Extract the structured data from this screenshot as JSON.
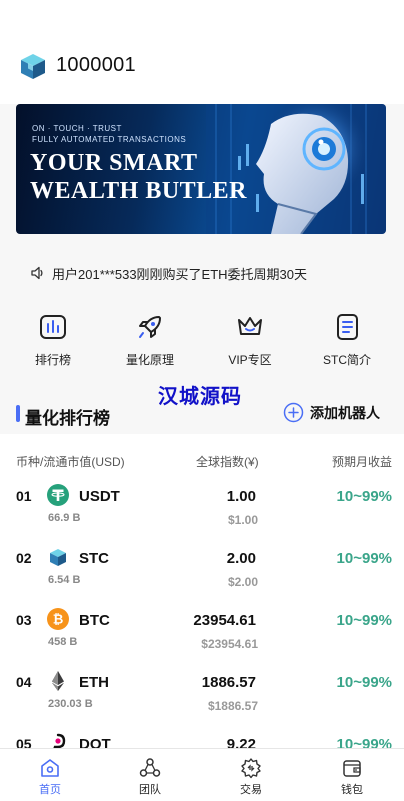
{
  "header": {
    "user_id": "1000001",
    "logo_icon": "cube-logo-icon"
  },
  "banner": {
    "line1": "ON · TOUCH · TRUST",
    "line2": "FULLY AUTOMATED TRANSACTIONS",
    "title1": "YOUR SMART",
    "title2": "WEALTH BUTLER"
  },
  "notice": {
    "icon": "speaker-icon",
    "text": "用户201***533刚刚购买了ETH委托周期30天"
  },
  "menu": [
    {
      "label": "排行榜",
      "icon": "ranking-chart-icon"
    },
    {
      "label": "量化原理",
      "icon": "rocket-icon"
    },
    {
      "label": "VIP专区",
      "icon": "crown-icon"
    },
    {
      "label": "STC简介",
      "icon": "document-icon"
    }
  ],
  "watermark": "汉城源码",
  "section": {
    "title": "量化排行榜",
    "add_label": "添加机器人"
  },
  "table": {
    "headers": {
      "coin": "币种/流通市值(USD)",
      "index": "全球指数(¥)",
      "return": "预期月收益"
    },
    "rows": [
      {
        "rank": "01",
        "symbol": "USDT",
        "cap": "66.9 B",
        "index": "1.00",
        "usd": "$1.00",
        "return": "10~99%",
        "icon": "usdt-icon",
        "color": "#26a17b"
      },
      {
        "rank": "02",
        "symbol": "STC",
        "cap": "6.54 B",
        "index": "2.00",
        "usd": "$2.00",
        "return": "10~99%",
        "icon": "stc-cube-icon",
        "color": "#3a8fc7"
      },
      {
        "rank": "03",
        "symbol": "BTC",
        "cap": "458 B",
        "index": "23954.61",
        "usd": "$23954.61",
        "return": "10~99%",
        "icon": "bitcoin-icon",
        "color": "#f7931a"
      },
      {
        "rank": "04",
        "symbol": "ETH",
        "cap": "230.03 B",
        "index": "1886.57",
        "usd": "$1886.57",
        "return": "10~99%",
        "icon": "ethereum-icon",
        "color": "#3c3c3d"
      },
      {
        "rank": "05",
        "symbol": "DOT",
        "cap": "",
        "index": "9.22",
        "usd": "",
        "return": "10~99%",
        "icon": "polkadot-icon",
        "color": "#e6007a"
      }
    ]
  },
  "tabbar": [
    {
      "label": "首页",
      "icon": "home-icon",
      "active": true
    },
    {
      "label": "团队",
      "icon": "team-icon",
      "active": false
    },
    {
      "label": "交易",
      "icon": "trade-gear-icon",
      "active": false
    },
    {
      "label": "钱包",
      "icon": "wallet-icon",
      "active": false
    }
  ],
  "colors": {
    "accent": "#4a6ef5",
    "return_green": "#3aa58a",
    "watermark": "#1212c8"
  }
}
